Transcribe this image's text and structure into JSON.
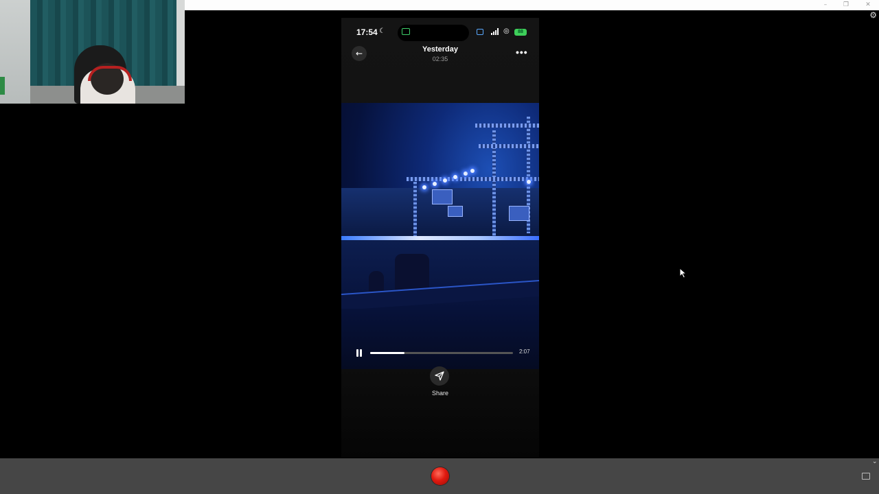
{
  "window": {
    "controls": [
      "–",
      "❐",
      "✕"
    ],
    "settings_icon": "⚙"
  },
  "phone": {
    "status_time": "17:54",
    "battery": "88",
    "header_title": "Yesterday",
    "header_subtitle": "02:35",
    "more_glyph": "•••",
    "back_glyph": "←",
    "duration": "2:07",
    "progress_fraction": 0.24,
    "share_label": "Share"
  },
  "colors": {
    "record": "#e11a10",
    "battery": "#3ecf5a",
    "toolbar": "#464646"
  }
}
